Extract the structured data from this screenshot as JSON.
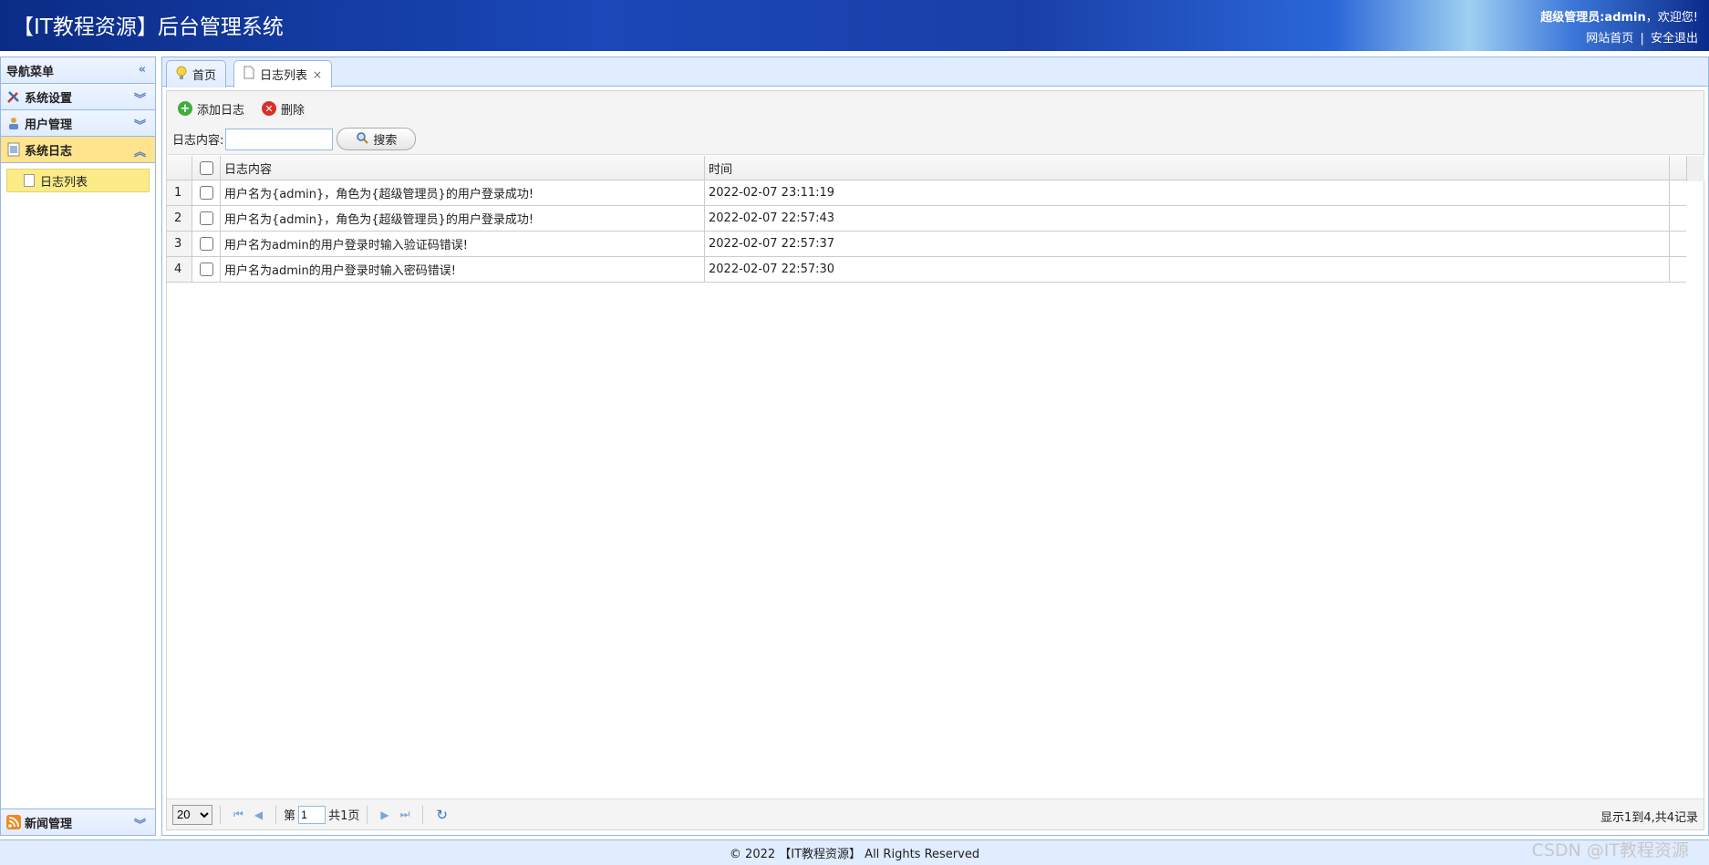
{
  "header": {
    "title": "【IT教程资源】后台管理系统",
    "welcome_role": "超级管理员:admin",
    "welcome_suffix": "，欢迎您!",
    "link_home": "网站首页",
    "link_sep": "|",
    "link_logout": "安全退出"
  },
  "sidebar": {
    "title": "导航菜单",
    "sections": [
      {
        "label": "系统设置",
        "icon": "tools-icon"
      },
      {
        "label": "用户管理",
        "icon": "users-icon"
      },
      {
        "label": "系统日志",
        "icon": "log-icon"
      }
    ],
    "sub_items": [
      {
        "label": "日志列表"
      }
    ],
    "bottom_section": {
      "label": "新闻管理",
      "icon": "rss-icon"
    }
  },
  "tabs": [
    {
      "label": "首页",
      "icon": "bulb-icon"
    },
    {
      "label": "日志列表",
      "icon": "page-icon",
      "close": "×"
    }
  ],
  "toolbar": {
    "add_label": "添加日志",
    "delete_label": "删除",
    "search_label": "日志内容:",
    "search_value": "",
    "search_button": "搜索"
  },
  "grid": {
    "columns": [
      "日志内容",
      "时间"
    ],
    "rows": [
      {
        "num": "1",
        "content": "用户名为{admin}，角色为{超级管理员}的用户登录成功!",
        "time": "2022-02-07 23:11:19"
      },
      {
        "num": "2",
        "content": "用户名为{admin}，角色为{超级管理员}的用户登录成功!",
        "time": "2022-02-07 22:57:43"
      },
      {
        "num": "3",
        "content": "用户名为admin的用户登录时输入验证码错误!",
        "time": "2022-02-07 22:57:37"
      },
      {
        "num": "4",
        "content": "用户名为admin的用户登录时输入密码错误!",
        "time": "2022-02-07 22:57:30"
      }
    ]
  },
  "pager": {
    "page_size": "20",
    "page_prefix": "第",
    "page_value": "1",
    "page_suffix": "共1页",
    "info": "显示1到4,共4记录"
  },
  "footer": {
    "text": "© 2022 【IT教程资源】 All Rights Reserved"
  },
  "watermark": "CSDN @IT教程资源",
  "colors": {
    "header": "#1a48b8",
    "accent_border": "#95b8e7",
    "active_section": "#ffe48d",
    "active_sub": "#fbec88"
  }
}
